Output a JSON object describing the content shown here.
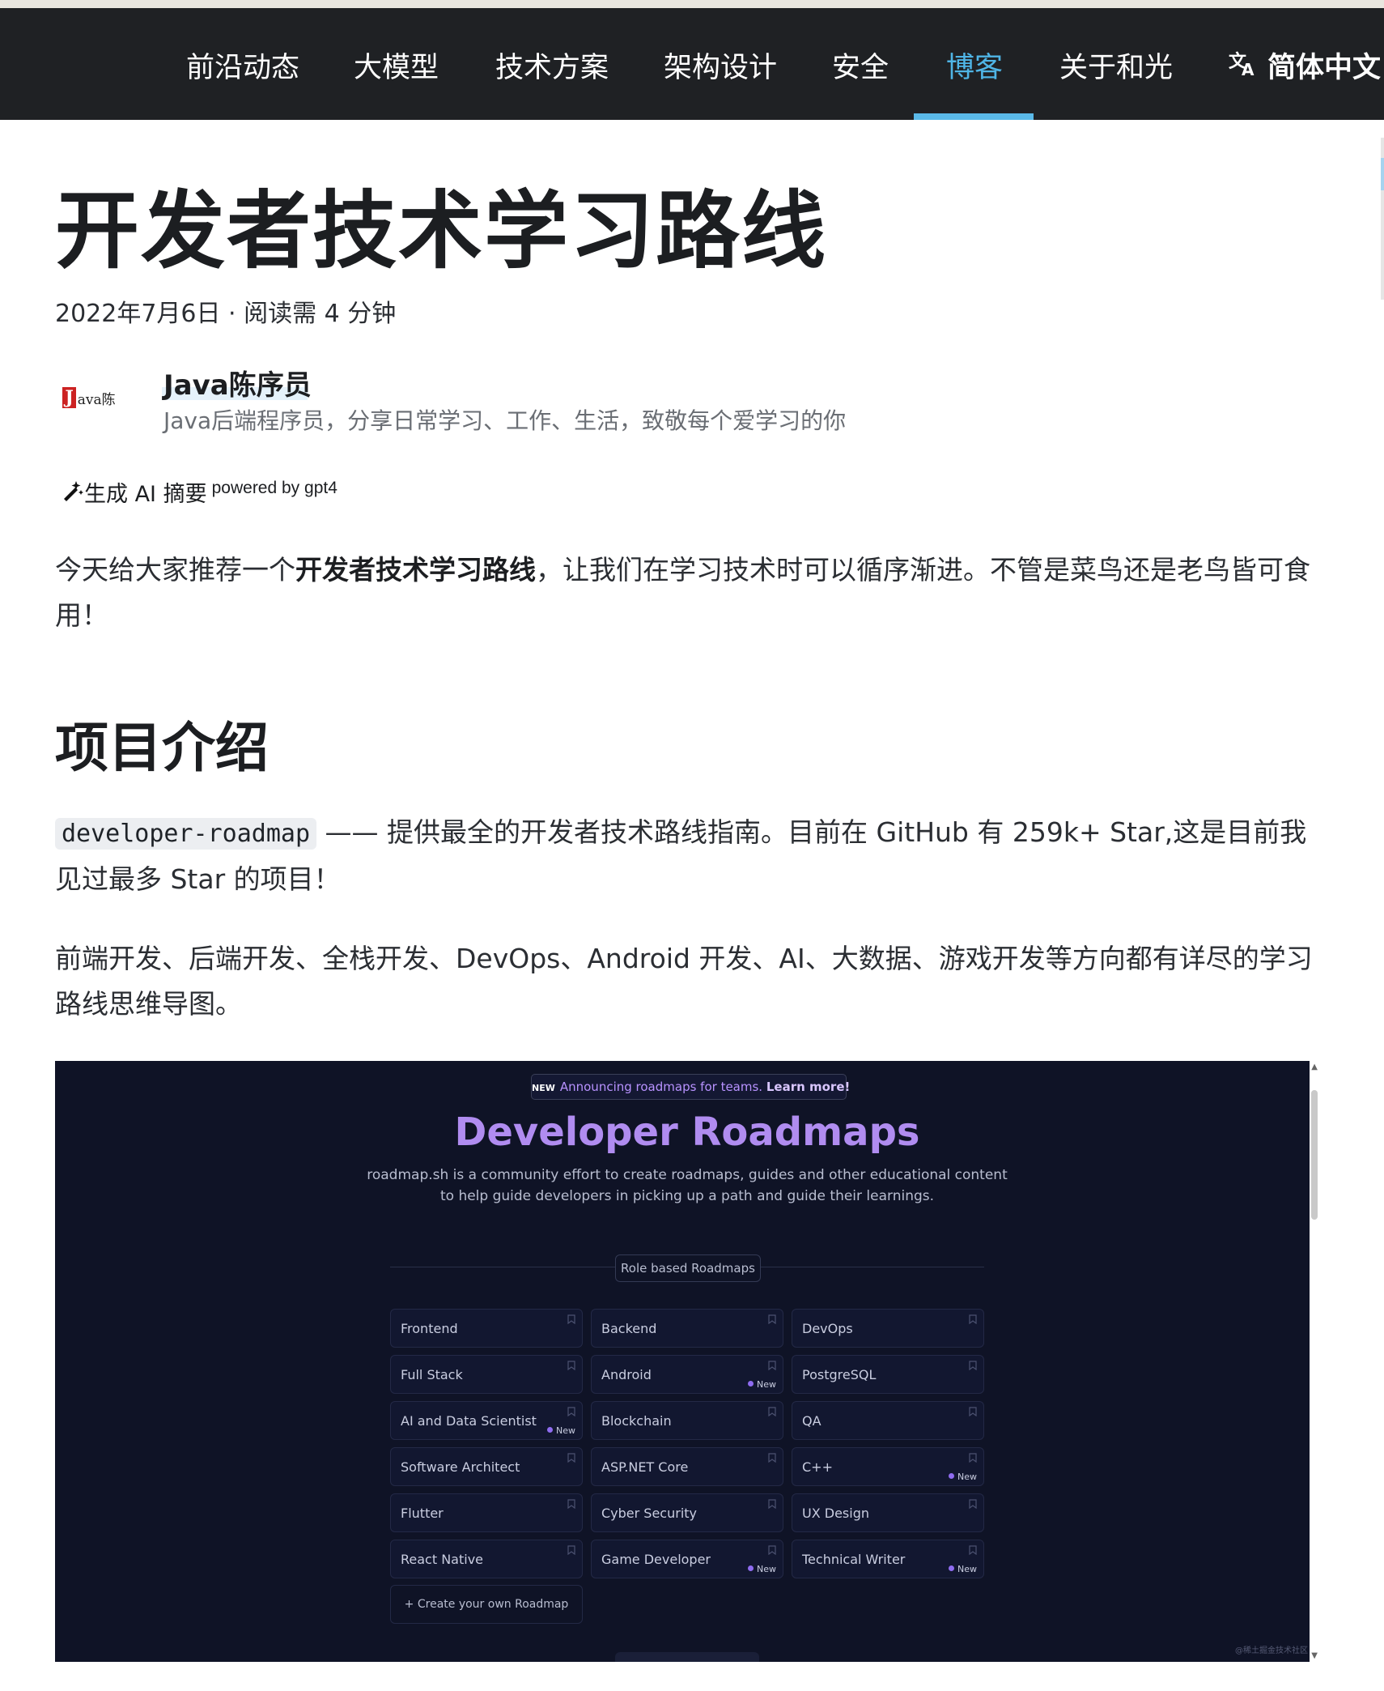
{
  "nav": {
    "items": [
      {
        "label": "前沿动态",
        "active": false
      },
      {
        "label": "大模型",
        "active": false
      },
      {
        "label": "技术方案",
        "active": false
      },
      {
        "label": "架构设计",
        "active": false
      },
      {
        "label": "安全",
        "active": false
      },
      {
        "label": "博客",
        "active": true
      },
      {
        "label": "关于和光",
        "active": false
      }
    ],
    "language": "简体中文",
    "language_icon": "translate-icon",
    "active_color": "#4fb5e6",
    "bg_color": "#1f2124"
  },
  "article": {
    "title": "开发者技术学习路线",
    "meta": "2022年7月6日 · 阅读需 4 分钟",
    "author": {
      "name": "Java陈序员",
      "bio": "Java后端程序员，分享日常学习、工作、生活，致敬每个爱学习的你",
      "avatar_text_j": "J",
      "avatar_text_rest": "ava陈"
    },
    "ai_summary": {
      "label": "生成 AI 摘要",
      "powered": "powered by gpt4",
      "icon": "magic-wand-icon"
    },
    "intro": {
      "before": "今天给大家推荐一个",
      "bold": "开发者技术学习路线",
      "after": "，让我们在学习技术时可以循序渐进。不管是菜鸟还是老鸟皆可食用！"
    },
    "section_heading": "项目介绍",
    "project": {
      "code": "developer-roadmap",
      "text": " —— 提供最全的开发者技术路线指南。目前在 GitHub 有 259k+ Star,这是目前我见过最多 Star 的项目！"
    },
    "directions": "前端开发、后端开发、全栈开发、DevOps、Android 开发、AI、大数据、游戏开发等方向都有详尽的学习路线思维导图。"
  },
  "screenshot": {
    "banner_new": "NEW",
    "banner_text": "Announcing roadmaps for teams.",
    "banner_link": "Learn more!",
    "title": "Developer Roadmaps",
    "subtitle_line1": "roadmap.sh is a community effort to create roadmaps, guides and other educational content",
    "subtitle_line2": "to help guide developers in picking up a path and guide their learnings.",
    "role_chip": "Role based Roadmaps",
    "new_label": "New",
    "cards": [
      {
        "label": "Frontend",
        "new": false
      },
      {
        "label": "Backend",
        "new": false
      },
      {
        "label": "DevOps",
        "new": false
      },
      {
        "label": "Full Stack",
        "new": false
      },
      {
        "label": "Android",
        "new": true
      },
      {
        "label": "PostgreSQL",
        "new": false
      },
      {
        "label": "AI and Data Scientist",
        "new": true
      },
      {
        "label": "Blockchain",
        "new": false
      },
      {
        "label": "QA",
        "new": false
      },
      {
        "label": "Software Architect",
        "new": false
      },
      {
        "label": "ASP.NET Core",
        "new": false
      },
      {
        "label": "C++",
        "new": true
      },
      {
        "label": "Flutter",
        "new": false
      },
      {
        "label": "Cyber Security",
        "new": false
      },
      {
        "label": "UX Design",
        "new": false
      },
      {
        "label": "React Native",
        "new": false
      },
      {
        "label": "Game Developer",
        "new": true
      },
      {
        "label": "Technical Writer",
        "new": true
      }
    ],
    "create": "+ Create your own Roadmap",
    "watermark": "@稀土掘金技术社区",
    "bg_color": "#0f1326",
    "accent": "#b08cf0"
  }
}
